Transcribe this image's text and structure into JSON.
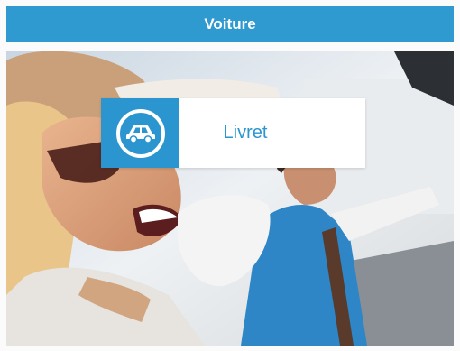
{
  "header": {
    "title": "Voiture"
  },
  "photo": {
    "description_icon": "photo-people-in-car"
  },
  "card": {
    "label": "Livret",
    "icon": "car-icon",
    "accent_color": "#2b95cf",
    "header_color": "#2f9ad0"
  }
}
